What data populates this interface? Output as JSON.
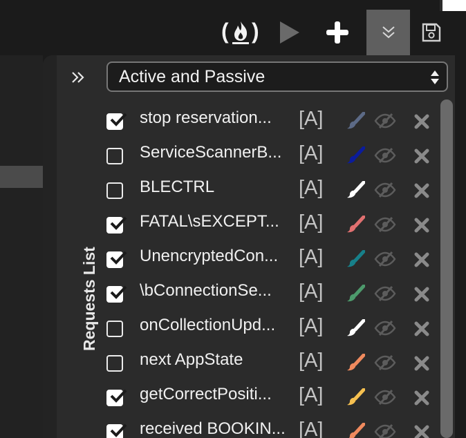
{
  "toolbar": {
    "fire_label": "(🔥)",
    "buttons": [
      "play-icon",
      "plus-icon",
      "chevrons-down-icon",
      "save-icon"
    ]
  },
  "panel": {
    "title": "Requests List",
    "mode_select": {
      "value": "Active and Passive"
    },
    "rows": [
      {
        "label": "stop reservation...",
        "tag": "[A]",
        "checked": true,
        "color": "#5c6a86"
      },
      {
        "label": "ServiceScannerB...",
        "tag": "[A]",
        "checked": false,
        "color": "#0b1c9c"
      },
      {
        "label": "BLECTRL",
        "tag": "[A]",
        "checked": false,
        "color": "#ffffff"
      },
      {
        "label": "FATAL\\sEXCEPT...",
        "tag": "[A]",
        "checked": true,
        "color": "#e07070"
      },
      {
        "label": "UnencryptedCon...",
        "tag": "[A]",
        "checked": true,
        "color": "#17808a"
      },
      {
        "label": "\\bConnectionSe...",
        "tag": "[A]",
        "checked": true,
        "color": "#4d9a6c"
      },
      {
        "label": "onCollectionUpd...",
        "tag": "[A]",
        "checked": false,
        "color": "#ffffff"
      },
      {
        "label": "next AppState",
        "tag": "[A]",
        "checked": false,
        "color": "#f08a5e"
      },
      {
        "label": "getCorrectPositi...",
        "tag": "[A]",
        "checked": true,
        "color": "#f5c050"
      },
      {
        "label": "received BOOKIN...",
        "tag": "[A]",
        "checked": true,
        "color": "#f08a5e"
      }
    ]
  }
}
